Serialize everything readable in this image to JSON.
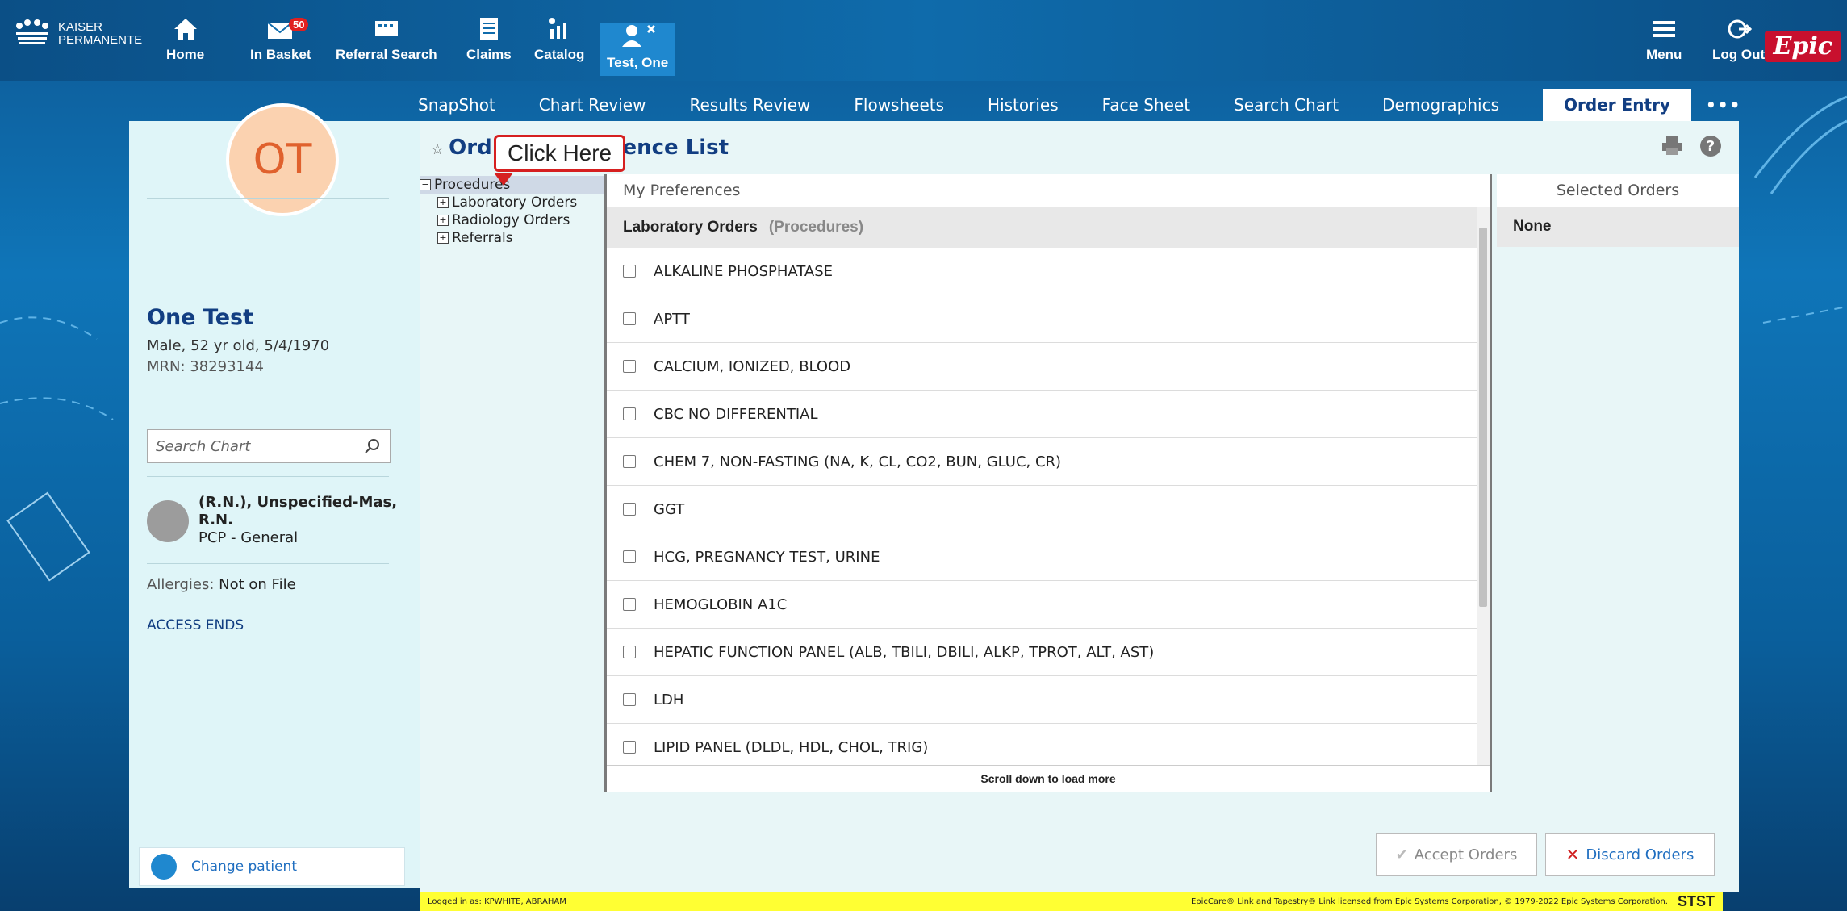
{
  "branding": {
    "org_line1": "KAISER",
    "org_line2": "PERMANENTE",
    "epic": "Epic"
  },
  "topnav": [
    {
      "label": "Home",
      "icon": "home-icon"
    },
    {
      "label": "In Basket",
      "icon": "mail-icon",
      "badge": "50"
    },
    {
      "label": "Referral Search",
      "icon": "referral-icon"
    },
    {
      "label": "Claims",
      "icon": "document-icon"
    },
    {
      "label": "Catalog",
      "icon": "catalog-icon"
    },
    {
      "label": "Test, One",
      "icon": "patient-icon"
    }
  ],
  "topright": {
    "menu": "Menu",
    "logout": "Log Out"
  },
  "tabs": [
    "SnapShot",
    "Chart Review",
    "Results Review",
    "Flowsheets",
    "Histories",
    "Face Sheet",
    "Search Chart",
    "Demographics",
    "Order Entry"
  ],
  "tabs_more": "•••",
  "patient": {
    "initials": "OT",
    "name": "One Test",
    "demographics": "Male, 52 yr old, 5/4/1970",
    "mrn": "MRN: 38293144",
    "search_placeholder": "Search Chart",
    "pcp_name": "(R.N.), Unspecified-Mas, R.N.",
    "pcp_role": "PCP - General",
    "allergies_label": "Allergies:",
    "allergies_value": "Not on File",
    "access": "ACCESS ENDS",
    "change_patient": "Change patient"
  },
  "page": {
    "title_left": "Ord",
    "title_right": "ference List",
    "callout": "Click Here"
  },
  "tree": {
    "root": "Procedures",
    "children": [
      "Laboratory Orders",
      "Radiology Orders",
      "Referrals"
    ]
  },
  "prefs": {
    "header": "My Preferences",
    "section": "Laboratory Orders",
    "section_sub": "(Procedures)",
    "items": [
      "ALKALINE PHOSPHATASE",
      "APTT",
      "CALCIUM, IONIZED, BLOOD",
      "CBC NO DIFFERENTIAL",
      "CHEM 7, NON-FASTING (NA, K, CL, CO2, BUN, GLUC, CR)",
      "GGT",
      "HCG, PREGNANCY TEST, URINE",
      "HEMOGLOBIN A1C",
      "HEPATIC FUNCTION PANEL (ALB, TBILI, DBILI, ALKP, TPROT, ALT, AST)",
      "LDH",
      "LIPID PANEL (DLDL, HDL, CHOL, TRIG)"
    ],
    "scroll_more": "Scroll down to load more"
  },
  "selected": {
    "header": "Selected Orders",
    "none": "None"
  },
  "buttons": {
    "accept": "Accept Orders",
    "discard": "Discard Orders"
  },
  "status": {
    "logged_in": "Logged in as: KPWHITE, ABRAHAM",
    "license": "EpicCare® Link and Tapestry® Link licensed from Epic Systems Corporation, © 1979-2022 Epic Systems Corporation.",
    "env": "STST"
  },
  "colors": {
    "brand_blue": "#0f6bab",
    "title_blue": "#123e82",
    "callout_red": "#d62020",
    "status_yellow": "#ffff33"
  }
}
